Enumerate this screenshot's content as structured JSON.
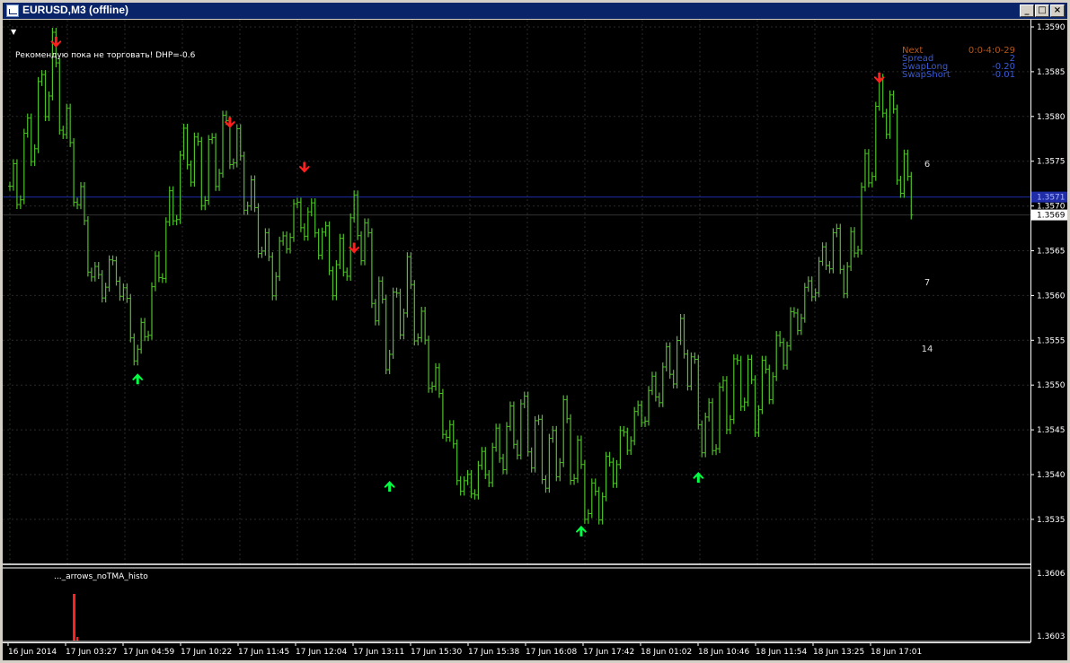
{
  "window": {
    "title": "EURUSD,M3 (offline)",
    "buttons": {
      "minimize": "_",
      "maximize": "□",
      "close": "×"
    }
  },
  "chart": {
    "menu_marker": "▼",
    "recommendation": "Рекомендую пока не торговать!  DHP=-0.6",
    "info_panel": [
      {
        "label": "Next",
        "value": "0:0-4:0-29",
        "color": "#b4581e"
      },
      {
        "label": "Spread",
        "value": "2",
        "color": "#3a5ad8"
      },
      {
        "label": "SwapLong",
        "value": "-0.20",
        "color": "#3a5ad8"
      },
      {
        "label": "SwapShort",
        "value": "-0.01",
        "color": "#3a5ad8"
      }
    ],
    "side_numbers": [
      "6",
      "7",
      "14"
    ],
    "price_axis": [
      "1.3590",
      "1.3585",
      "1.3580",
      "1.3575",
      "1.3570",
      "1.3565",
      "1.3560",
      "1.3555",
      "1.3550",
      "1.3545",
      "1.3540",
      "1.3535"
    ],
    "current_price": "1.3569",
    "blue_line_price": "1.3571",
    "subwindow": {
      "indicator_label": "..._arrows_noTMA_histo",
      "scale": [
        "1.3606",
        "1.3603"
      ]
    },
    "time_axis": [
      "16 Jun 2014",
      "17 Jun 03:27",
      "17 Jun 04:59",
      "17 Jun 10:22",
      "17 Jun 11:45",
      "17 Jun 12:04",
      "17 Jun 13:11",
      "17 Jun 15:30",
      "17 Jun 15:38",
      "17 Jun 16:08",
      "17 Jun 17:42",
      "18 Jun 01:02",
      "18 Jun 10:46",
      "18 Jun 11:54",
      "18 Jun 13:25",
      "18 Jun 17:01"
    ],
    "colors": {
      "bars": "#4fbf2a",
      "sell_arrow": "#ff1f1f",
      "buy_arrow": "#00ff44",
      "blue_line": "#1f2ea8",
      "grid": "#2a2a2a"
    }
  },
  "chart_data": {
    "type": "line",
    "description_key": "bars",
    "ylim": [
      1.353,
      1.3591
    ],
    "pivots": [
      {
        "bar": 0,
        "price": 1.357
      },
      {
        "bar": 12,
        "price": 1.3586
      },
      {
        "bar": 24,
        "price": 1.3561
      },
      {
        "bar": 30,
        "price": 1.3563
      },
      {
        "bar": 36,
        "price": 1.3553
      },
      {
        "bar": 50,
        "price": 1.3577
      },
      {
        "bar": 54,
        "price": 1.3573
      },
      {
        "bar": 62,
        "price": 1.3578
      },
      {
        "bar": 74,
        "price": 1.3562
      },
      {
        "bar": 80,
        "price": 1.3569
      },
      {
        "bar": 86,
        "price": 1.3568
      },
      {
        "bar": 92,
        "price": 1.3562
      },
      {
        "bar": 98,
        "price": 1.3569
      },
      {
        "bar": 106,
        "price": 1.3555
      },
      {
        "bar": 112,
        "price": 1.3561
      },
      {
        "bar": 128,
        "price": 1.3538
      },
      {
        "bar": 144,
        "price": 1.3546
      },
      {
        "bar": 152,
        "price": 1.3541
      },
      {
        "bar": 156,
        "price": 1.3545
      },
      {
        "bar": 164,
        "price": 1.3536
      },
      {
        "bar": 172,
        "price": 1.3543
      },
      {
        "bar": 190,
        "price": 1.3555
      },
      {
        "bar": 196,
        "price": 1.3544
      },
      {
        "bar": 206,
        "price": 1.3551
      },
      {
        "bar": 210,
        "price": 1.3548
      },
      {
        "bar": 232,
        "price": 1.3566
      },
      {
        "bar": 236,
        "price": 1.3562
      },
      {
        "bar": 246,
        "price": 1.3583
      },
      {
        "bar": 254,
        "price": 1.3569
      }
    ],
    "sell_arrows_price": [
      1.3587,
      1.3578,
      1.3573,
      1.3564,
      1.3583
    ],
    "sell_arrows_bar": [
      13,
      62,
      83,
      97,
      245
    ],
    "buy_arrows_price": [
      1.3552,
      1.354,
      1.3535,
      1.3541
    ],
    "buy_arrows_bar": [
      36,
      107,
      161,
      194
    ]
  }
}
